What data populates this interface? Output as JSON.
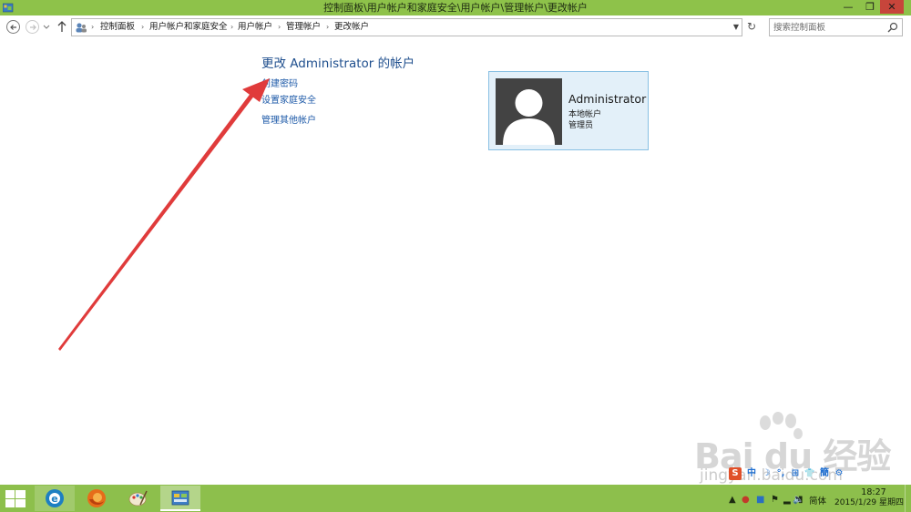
{
  "window": {
    "title": "控制面板\\用户帐户和家庭安全\\用户帐户\\管理帐户\\更改帐户",
    "minimize_glyph": "—",
    "maximize_glyph": "❐",
    "close_glyph": "✕"
  },
  "address_bar": {
    "breadcrumbs": [
      "控制面板",
      "用户帐户和家庭安全",
      "用户帐户",
      "管理帐户",
      "更改帐户"
    ],
    "separator": "›"
  },
  "search": {
    "placeholder": "搜索控制面板"
  },
  "main": {
    "page_title": "更改 Administrator 的帐户",
    "links": [
      "创建密码",
      "设置家庭安全",
      "管理其他帐户"
    ]
  },
  "account": {
    "name": "Administrator",
    "type": "本地帐户",
    "role": "管理员"
  },
  "watermark": {
    "brand": "Bai du 经验",
    "url": "jingyan.baidu.com"
  },
  "ime_bar": {
    "items": [
      "S",
      "中",
      "☽",
      "°,",
      "⊞",
      "👕",
      "簡",
      "⚙"
    ]
  },
  "taskbar": {
    "apps": [
      "Internet Explorer",
      "Firefox",
      "Paint",
      "Control Panel"
    ],
    "language": "简体",
    "time": "18:27",
    "date": "2015/1/29 星期四"
  },
  "colors": {
    "titlebar": "#8ec24a",
    "taskbar": "#8dbf4c",
    "link": "#1e5aa8",
    "title_text": "#1f4f8e",
    "tile_bg": "#e3f0f9",
    "tile_border": "#88c0e3",
    "annotation_arrow": "#e03b3b",
    "close_button": "#c7453b"
  }
}
